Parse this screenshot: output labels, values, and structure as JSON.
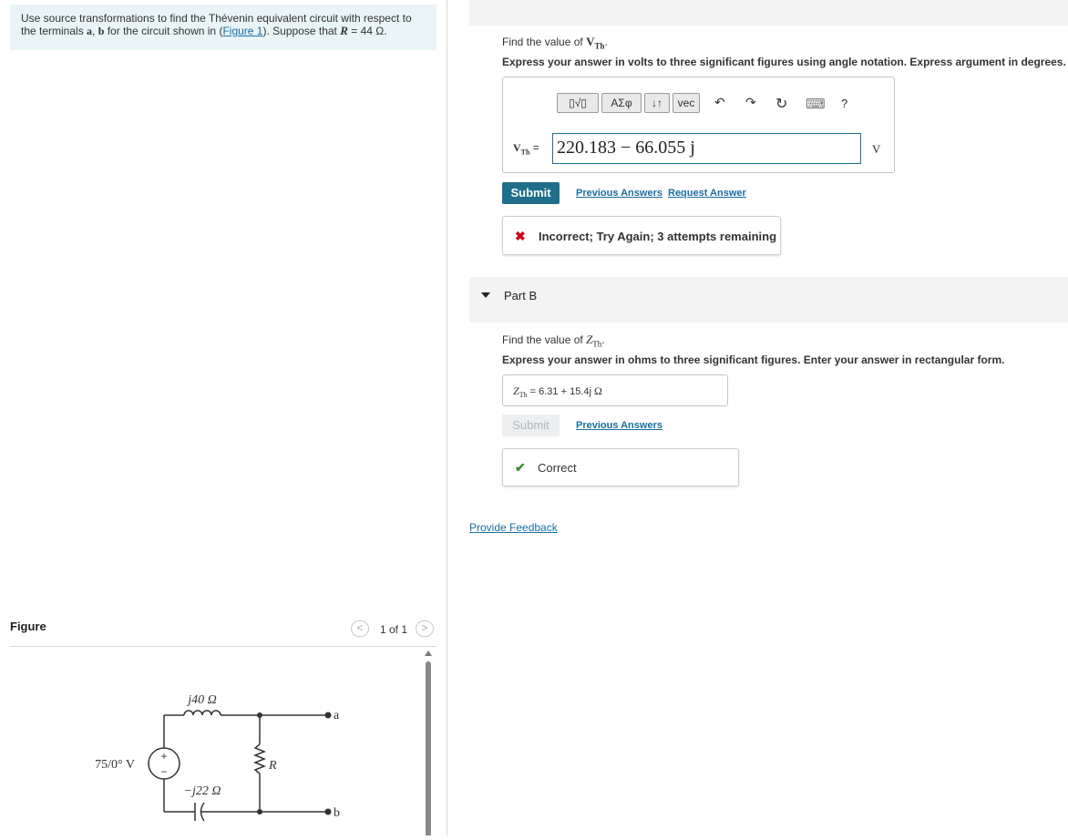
{
  "problem": {
    "text_a": "Use source transformations to find the Thévenin equivalent circuit with respect to the terminals ",
    "terminal_a": "a",
    "comma": ", ",
    "terminal_b": "b",
    "text_b": " for the circuit shown in (",
    "figure_link": "Figure 1",
    "text_c": "). Suppose that ",
    "r_symbol": "R",
    "r_value": " = 44 Ω."
  },
  "figure": {
    "label": "Figure",
    "pager": "1 of 1",
    "prev": "<",
    "next": ">",
    "circuit": {
      "inductor": "j40 Ω",
      "capacitor": "−j22 Ω",
      "source": "75/0° V",
      "resistor": "R",
      "plus": "+",
      "minus": "−",
      "terminal_a": "a",
      "terminal_b": "b"
    }
  },
  "partA": {
    "prompt_prefix": "Find the value of ",
    "prompt_var": "V",
    "prompt_sub": "Th",
    "prompt_suffix": ".",
    "instruction": "Express your answer in volts to three significant figures using angle notation. Express argument in degrees.",
    "toolbar": {
      "templates": "▯√▯",
      "greek": "ΑΣφ",
      "arrows": "↓↑",
      "vec": "vec",
      "undo": "↶",
      "redo": "↷",
      "reset": "↻",
      "keyboard": "⌨",
      "help": "?"
    },
    "answer_var": "V",
    "answer_sub": "Th",
    "answer_eq": " = ",
    "answer_value": "220.183 − 66.055 j",
    "unit": "V",
    "submit_label": "Submit",
    "previous_answers": "Previous Answers",
    "request_answer": "Request Answer",
    "feedback_icon": "✖",
    "feedback_text": "Incorrect; Try Again; 3 attempts remaining",
    "feedback_color": "#d0021b"
  },
  "partB": {
    "title": "Part B",
    "prompt_prefix": "Find the value of ",
    "prompt_var": "Z",
    "prompt_sub": "Th",
    "prompt_suffix": ".",
    "instruction": "Express your answer in ohms to three significant figures. Enter your answer in rectangular form.",
    "answer_var": "Z",
    "answer_sub": "Th",
    "answer_eq": " = ",
    "answer_value": "6.31 + 15.4j",
    "unit": "Ω",
    "submit_label": "Submit",
    "previous_answers": "Previous Answers",
    "feedback_icon": "✔",
    "feedback_text": "Correct",
    "feedback_color": "#3d8b2f"
  },
  "provide_feedback": "Provide Feedback"
}
